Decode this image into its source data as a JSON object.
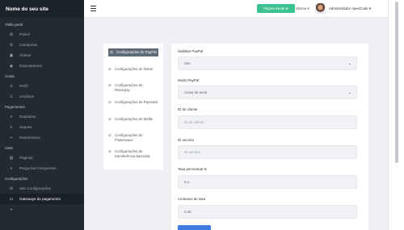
{
  "site_name": "Nome do seu site",
  "sidebar": {
    "sections": [
      {
        "title": "Visão geral",
        "items": [
          {
            "icon": "grid-icon",
            "glyph": "⊞",
            "label": "Painel"
          },
          {
            "icon": "categories-icon",
            "glyph": "⚙",
            "label": "Categorias"
          },
          {
            "icon": "video-icon",
            "glyph": "▣",
            "label": "Vídeos"
          },
          {
            "icon": "eye-icon",
            "glyph": "◉",
            "label": "Espectadores"
          }
        ]
      },
      {
        "title": "Conta",
        "items": [
          {
            "icon": "user-icon",
            "glyph": "♙",
            "label": "Perfil"
          },
          {
            "icon": "users-icon",
            "glyph": "♙",
            "label": "Usuários"
          }
        ]
      },
      {
        "title": "Pagamentos",
        "items": [
          {
            "icon": "deposits-icon",
            "glyph": "≡",
            "label": "Depósitos"
          },
          {
            "icon": "withdraw-icon",
            "glyph": "≡",
            "label": "Saques"
          },
          {
            "icon": "refund-icon",
            "glyph": "↩",
            "label": "Reembolsos"
          }
        ]
      },
      {
        "title": "CMS",
        "items": [
          {
            "icon": "pages-icon",
            "glyph": "▤",
            "label": "Páginas"
          },
          {
            "icon": "faq-icon",
            "glyph": "≡",
            "label": "Perguntas Frequentes"
          }
        ]
      },
      {
        "title": "Configurações",
        "items": [
          {
            "icon": "gear-icon",
            "glyph": "⚙",
            "label": "Site Configurações"
          },
          {
            "icon": "payment-gateway-icon",
            "glyph": "▭",
            "label": "Gateways de pagamento",
            "active": true
          },
          {
            "icon": "crosshair-icon",
            "glyph": "⌖",
            "label": ""
          }
        ]
      }
    ]
  },
  "topbar": {
    "site_button": "Página Inicial",
    "site_button_icon": "send-icon",
    "language": "Idioma",
    "username": "Administrador ApexCode"
  },
  "tabs": [
    {
      "label": "Configurações do PayPal",
      "active": true
    },
    {
      "label": "Configurações de listras"
    },
    {
      "label": "Configurações do Razorpay"
    },
    {
      "label": "Configurações do Paystack"
    },
    {
      "label": "Configurações de Mollie"
    },
    {
      "label": "Configurações do Flutterwave"
    },
    {
      "label": "Configurações de transferência bancária"
    }
  ],
  "form": {
    "enable_label": "Habilitar PayPal",
    "enable_value": "Sim",
    "mode_label": "Modo PayPal",
    "mode_value": "Caixa de areia",
    "client_id_label": "ID do cliente",
    "client_id_placeholder": "ID do cliente",
    "secret_label": "ID secreto",
    "secret_placeholder": "ID secreto",
    "fee_percent_label": "Taxa percentual %",
    "fee_percent_value": "5.4",
    "fee_cents_label": "Centavos de taxa",
    "fee_cents_value": "0.30"
  },
  "colors": {
    "sidebar_bg": "#232a33",
    "accent_green": "#3cc28f",
    "accent_blue": "#3f7be0",
    "active_tab": "#606b78"
  }
}
